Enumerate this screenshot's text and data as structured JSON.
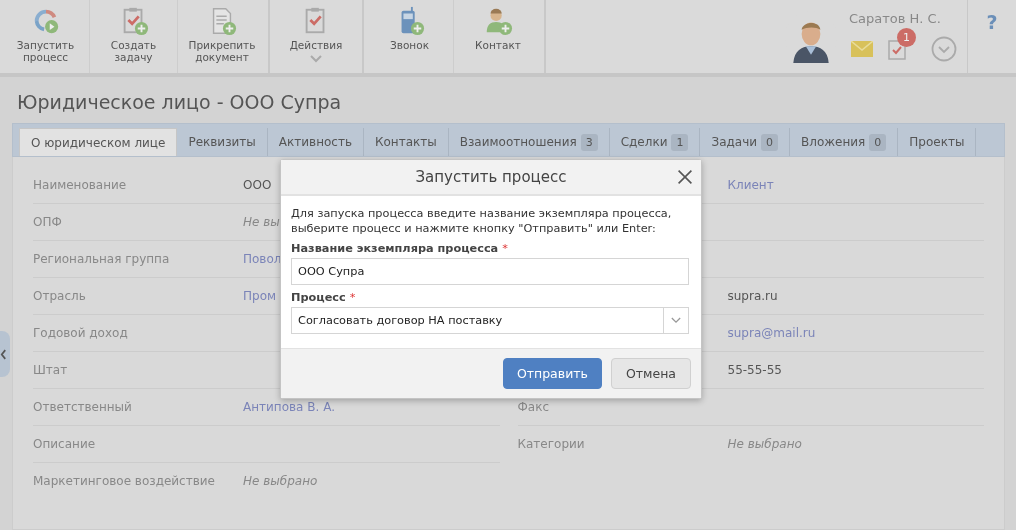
{
  "toolbar": {
    "groups": [
      [
        {
          "label": "Запустить процесс",
          "dropdown": false
        },
        {
          "label": "Создать задачу",
          "dropdown": false
        },
        {
          "label": "Прикрепить документ",
          "dropdown": false
        }
      ],
      [
        {
          "label": "Действия",
          "dropdown": true
        }
      ],
      [
        {
          "label": "Звонок",
          "dropdown": false
        },
        {
          "label": "Контакт",
          "dropdown": false
        }
      ]
    ],
    "user": {
      "name": "Саратов Н. С.",
      "task_count": "1"
    },
    "help": "?"
  },
  "page_title": "Юридическое лицо - ООО Супра",
  "tabs": [
    {
      "label": "О юридическом лице",
      "selected": true
    },
    {
      "label": "Реквизиты",
      "selected": false
    },
    {
      "label": "Активность",
      "selected": false
    },
    {
      "label": "Контакты",
      "selected": false
    },
    {
      "label": "Взаимоотношения",
      "count": "3",
      "selected": false
    },
    {
      "label": "Сделки",
      "count": "1",
      "selected": false
    },
    {
      "label": "Задачи",
      "count": "0",
      "selected": false
    },
    {
      "label": "Вложения",
      "count": "0",
      "selected": false
    },
    {
      "label": "Проекты",
      "selected": false
    }
  ],
  "fields_left": [
    {
      "label": "Наименование",
      "value": "ООО",
      "kind": "text"
    },
    {
      "label": "ОПФ",
      "value": "Не вы",
      "kind": "unset"
    },
    {
      "label": "Региональная группа",
      "value": "Повол",
      "kind": "link"
    },
    {
      "label": "Отрасль",
      "value": "Пром",
      "kind": "link"
    },
    {
      "label": "Годовой доход"
    },
    {
      "label": "Штат"
    },
    {
      "label": "Ответственный",
      "value": "Антипова В. А.",
      "kind": "link"
    },
    {
      "label": "Описание"
    },
    {
      "label": "Маркетинговое воздействие",
      "value": "Не выбрано",
      "kind": "unset"
    }
  ],
  "fields_right": [
    {
      "value": "Клиент",
      "kind": "link"
    },
    {
      "kind": "empty"
    },
    {
      "kind": "empty"
    },
    {
      "value": "supra.ru",
      "kind": "text"
    },
    {
      "value": "supra@mail.ru",
      "kind": "link"
    },
    {
      "value": "55-55-55",
      "kind": "text"
    },
    {
      "label": "Факс"
    },
    {
      "label": "Категории",
      "value": "Не выбрано",
      "kind": "unset"
    }
  ],
  "dialog": {
    "title": "Запустить процесс",
    "instructions": "Для запуска процесса введите название экземпляра процесса, выберите процесс и нажмите кнопку \"Отправить\" или Enter:",
    "name_label": "Название экземпляра процесса",
    "name_value": "ООО Супра",
    "process_label": "Процесс",
    "process_value": "Согласовать договор НА поставку",
    "required_mark": "*",
    "buttons": [
      {
        "label": "Отправить",
        "kind": "primary"
      },
      {
        "label": "Отмена",
        "kind": "secondary"
      }
    ]
  }
}
